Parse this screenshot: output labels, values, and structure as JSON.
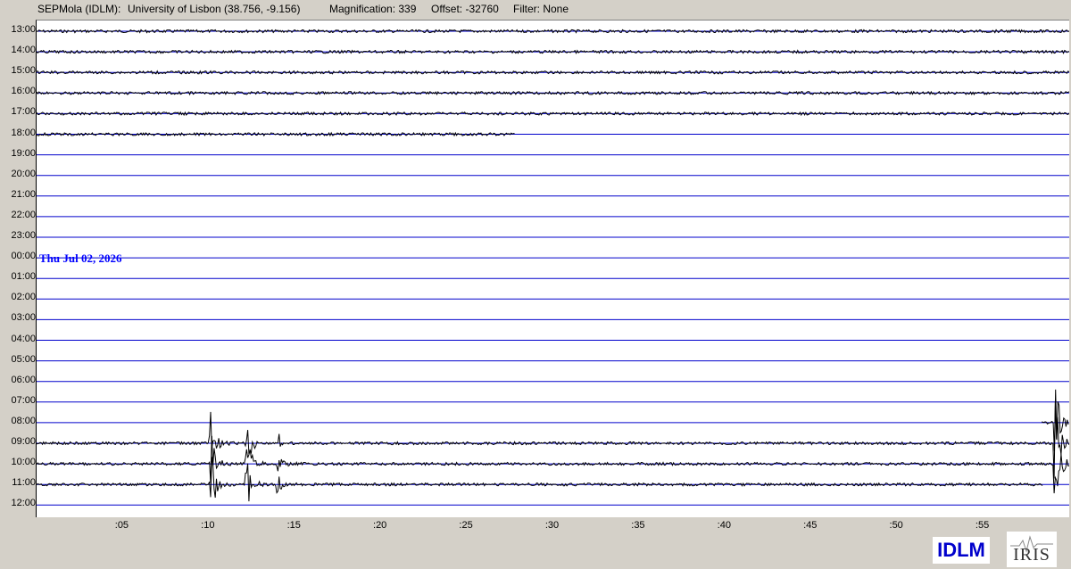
{
  "header": {
    "station": "SEPMola (IDLM):",
    "location": "University of Lisbon (38.756, -9.156)",
    "magnification": "Magnification: 339",
    "offset": "Offset: -32760",
    "filter": "Filter: None"
  },
  "date_annotation": "Thu Jul 02, 2026",
  "station_logo": "IDLM",
  "network_logo": "IRIS",
  "colors": {
    "line": "#0000cc",
    "trace": "#000000",
    "background": "#d4d0c8",
    "plot_bg": "#ffffff",
    "date_label": "#0000ff"
  },
  "chart_data": {
    "type": "line",
    "x_range_minutes": [
      0,
      60
    ],
    "x_tick_labels": [
      ":05",
      ":10",
      ":15",
      ":20",
      ":25",
      ":30",
      ":35",
      ":40",
      ":45",
      ":50",
      ":55"
    ],
    "x_tick_values": [
      5,
      10,
      15,
      20,
      25,
      30,
      35,
      40,
      45,
      50,
      55
    ],
    "row_labels": [
      "13:00",
      "14:00",
      "15:00",
      "16:00",
      "17:00",
      "18:00",
      "19:00",
      "20:00",
      "21:00",
      "22:00",
      "23:00",
      "00:00",
      "01:00",
      "02:00",
      "03:00",
      "04:00",
      "05:00",
      "06:00",
      "07:00",
      "08:00",
      "09:00",
      "10:00",
      "11:00",
      "12:00"
    ],
    "rows": [
      {
        "label": "13:00",
        "data_start": 0,
        "data_end": 60
      },
      {
        "label": "14:00",
        "data_start": 0,
        "data_end": 60
      },
      {
        "label": "15:00",
        "data_start": 0,
        "data_end": 60
      },
      {
        "label": "16:00",
        "data_start": 0,
        "data_end": 60
      },
      {
        "label": "17:00",
        "data_start": 0,
        "data_end": 60
      },
      {
        "label": "18:00",
        "data_start": 0,
        "data_end": 27.8
      },
      {
        "label": "19:00"
      },
      {
        "label": "20:00"
      },
      {
        "label": "21:00"
      },
      {
        "label": "22:00"
      },
      {
        "label": "23:00"
      },
      {
        "label": "00:00"
      },
      {
        "label": "01:00"
      },
      {
        "label": "02:00"
      },
      {
        "label": "03:00"
      },
      {
        "label": "04:00"
      },
      {
        "label": "05:00"
      },
      {
        "label": "06:00"
      },
      {
        "label": "07:00"
      },
      {
        "label": "08:00",
        "data_start": 58.4,
        "data_end": 60
      },
      {
        "label": "09:00",
        "data_start": 0,
        "data_end": 60
      },
      {
        "label": "10:00",
        "data_start": 0,
        "data_end": 60
      },
      {
        "label": "11:00",
        "data_start": 0,
        "data_end": 58.5
      },
      {
        "label": "12:00"
      }
    ],
    "events": [
      {
        "minute": 10.1
      },
      {
        "minute": 12.2
      },
      {
        "minute": 14.0
      },
      {
        "minute": 59.2
      }
    ]
  }
}
